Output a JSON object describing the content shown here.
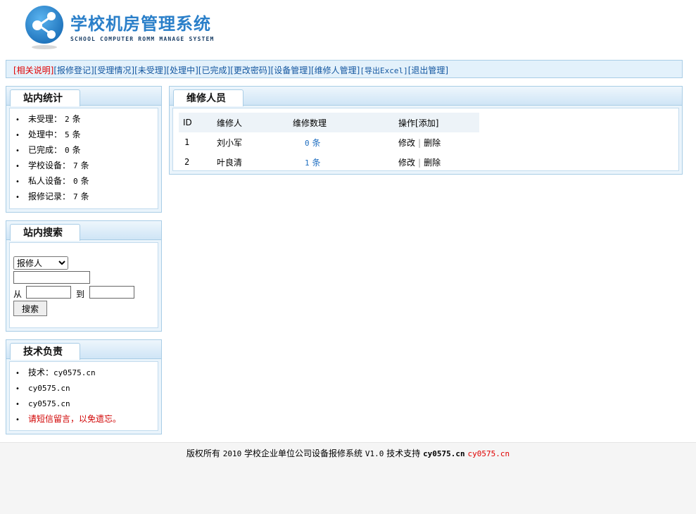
{
  "header": {
    "title": "学校机房管理系统",
    "subtitle": "SCHOOL COMPUTER ROMM MANAGE SYSTEM"
  },
  "nav": [
    {
      "label": "[相关说明]",
      "style": "red"
    },
    {
      "label": "[报修登记]"
    },
    {
      "label": "[受理情况]"
    },
    {
      "label": "[未受理]"
    },
    {
      "label": "[处理中]"
    },
    {
      "label": "[已完成]"
    },
    {
      "label": "[更改密码]"
    },
    {
      "label": "[设备管理]"
    },
    {
      "label": "[维修人管理]"
    },
    {
      "label": "[导出Excel]"
    },
    {
      "label": "[退出管理]"
    }
  ],
  "stats": {
    "title": "站内统计",
    "items": [
      {
        "label": "未受理：",
        "value": "2",
        "unit": "条"
      },
      {
        "label": "处理中：",
        "value": "5",
        "unit": "条"
      },
      {
        "label": "已完成：",
        "value": "0",
        "unit": "条"
      },
      {
        "label": "学校设备：",
        "value": "7",
        "unit": "条"
      },
      {
        "label": "私人设备：",
        "value": "0",
        "unit": "条"
      },
      {
        "label": "报修记录：",
        "value": "7",
        "unit": "条"
      }
    ]
  },
  "search": {
    "title": "站内搜索",
    "select_value": "报修人",
    "keyword_value": "",
    "from_label": "从",
    "to_label": "到",
    "from_value": "",
    "to_value": "",
    "button_label": "搜索"
  },
  "support": {
    "title": "技术负责",
    "line1_label": "技术：",
    "line1_value": "cy0575.cn",
    "line2": "cy0575.cn",
    "line3": "cy0575.cn",
    "note": "请短信留言，以免遗忘。"
  },
  "main": {
    "title": "维修人员",
    "columns": [
      "ID",
      "维修人",
      "维修数理",
      "操作"
    ],
    "add_label": "[添加]",
    "rows": [
      {
        "id": "1",
        "name": "刘小军",
        "count": "0",
        "unit": "条",
        "edit": "修改",
        "delete": "删除"
      },
      {
        "id": "2",
        "name": "叶良清",
        "count": "1",
        "unit": "条",
        "edit": "修改",
        "delete": "删除"
      }
    ]
  },
  "footer": {
    "prefix": "版权所有",
    "year": "2010",
    "system": "学校企业单位公司设备报修系统",
    "version": "V1.0",
    "support_label": "技术支持",
    "link1": "cy0575.cn",
    "link2": "cy0575.cn"
  },
  "colors": {
    "accent": "#2a7fc9",
    "nav_bg": "#e3f1fb",
    "border": "#a9cde6",
    "red": "#e00000",
    "link": "#1457a0"
  }
}
